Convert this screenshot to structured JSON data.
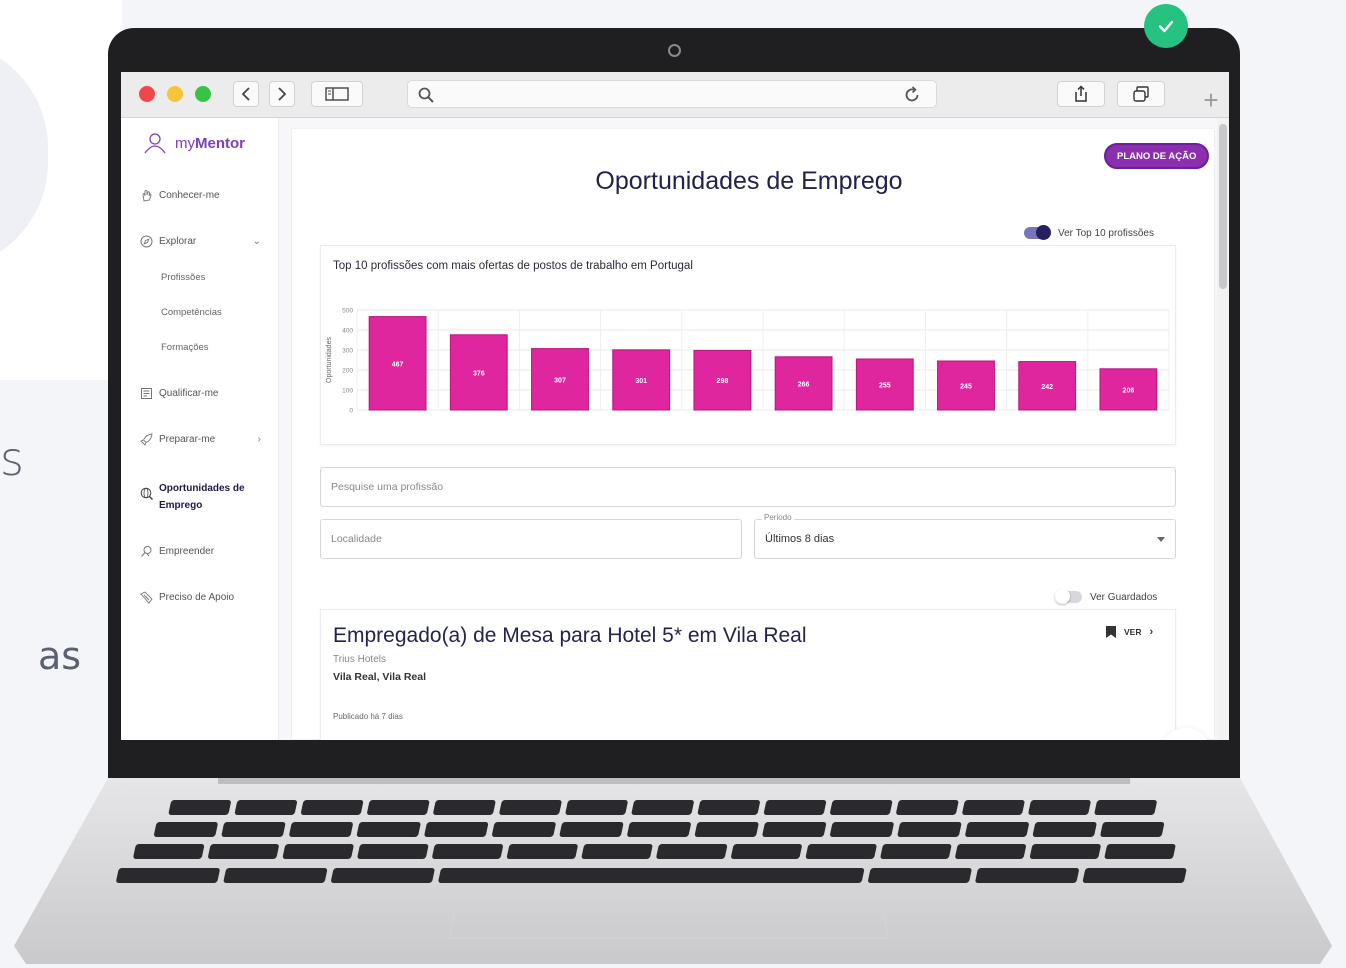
{
  "background": {
    "fragment_1": "s",
    "fragment_2": "as"
  },
  "browser": {
    "url": ""
  },
  "sidebar": {
    "brand_my": "my",
    "brand_mentor": "Mentor",
    "items": [
      {
        "label": "Conhecer-me",
        "icon": "hand-icon"
      },
      {
        "label": "Explorar",
        "icon": "compass-icon"
      },
      {
        "label": "Qualificar-me",
        "icon": "certificate-icon"
      },
      {
        "label": "Preparar-me",
        "icon": "rocket-icon"
      },
      {
        "label": "Oportunidades de",
        "label2": "Emprego",
        "icon": "search-globe-icon"
      },
      {
        "label": "Empreender",
        "icon": "lightbulb-icon"
      },
      {
        "label": "Preciso de Apoio",
        "icon": "support-icon"
      }
    ],
    "explorar_sub": [
      "Profissões",
      "Competências",
      "Formações"
    ]
  },
  "main": {
    "plano_button": "PLANO DE AÇÃO",
    "title": "Oportunidades de Emprego",
    "toggle_top10": "Ver Top 10 profissões",
    "search_placeholder": "Pesquise uma profissão",
    "localidade_placeholder": "Localidade",
    "periodo_label": "Periodo",
    "periodo_value": "Últimos 8 dias",
    "toggle_saved": "Ver Guardados"
  },
  "chart_data": {
    "type": "bar",
    "title": "Top 10 profissões com mais ofertas de postos de trabalho em Portugal",
    "ylabel": "Oportunidades",
    "xlabel": "",
    "ylim": [
      0,
      500
    ],
    "yticks": [
      0,
      100,
      200,
      300,
      400,
      500
    ],
    "values": [
      467,
      376,
      307,
      301,
      298,
      266,
      255,
      245,
      242,
      206
    ],
    "bar_color": "#e0269e"
  },
  "job": {
    "title": "Empregado(a) de Mesa para Hotel 5* em Vila Real",
    "company": "Trius Hotels",
    "location": "Vila Real,  Vila Real",
    "published": "Publicado há 7 dias",
    "ver_label": "VER"
  },
  "colors": {
    "accent": "#8c2fae",
    "title": "#22214e",
    "bars": "#e0269e",
    "check": "#26c281"
  }
}
